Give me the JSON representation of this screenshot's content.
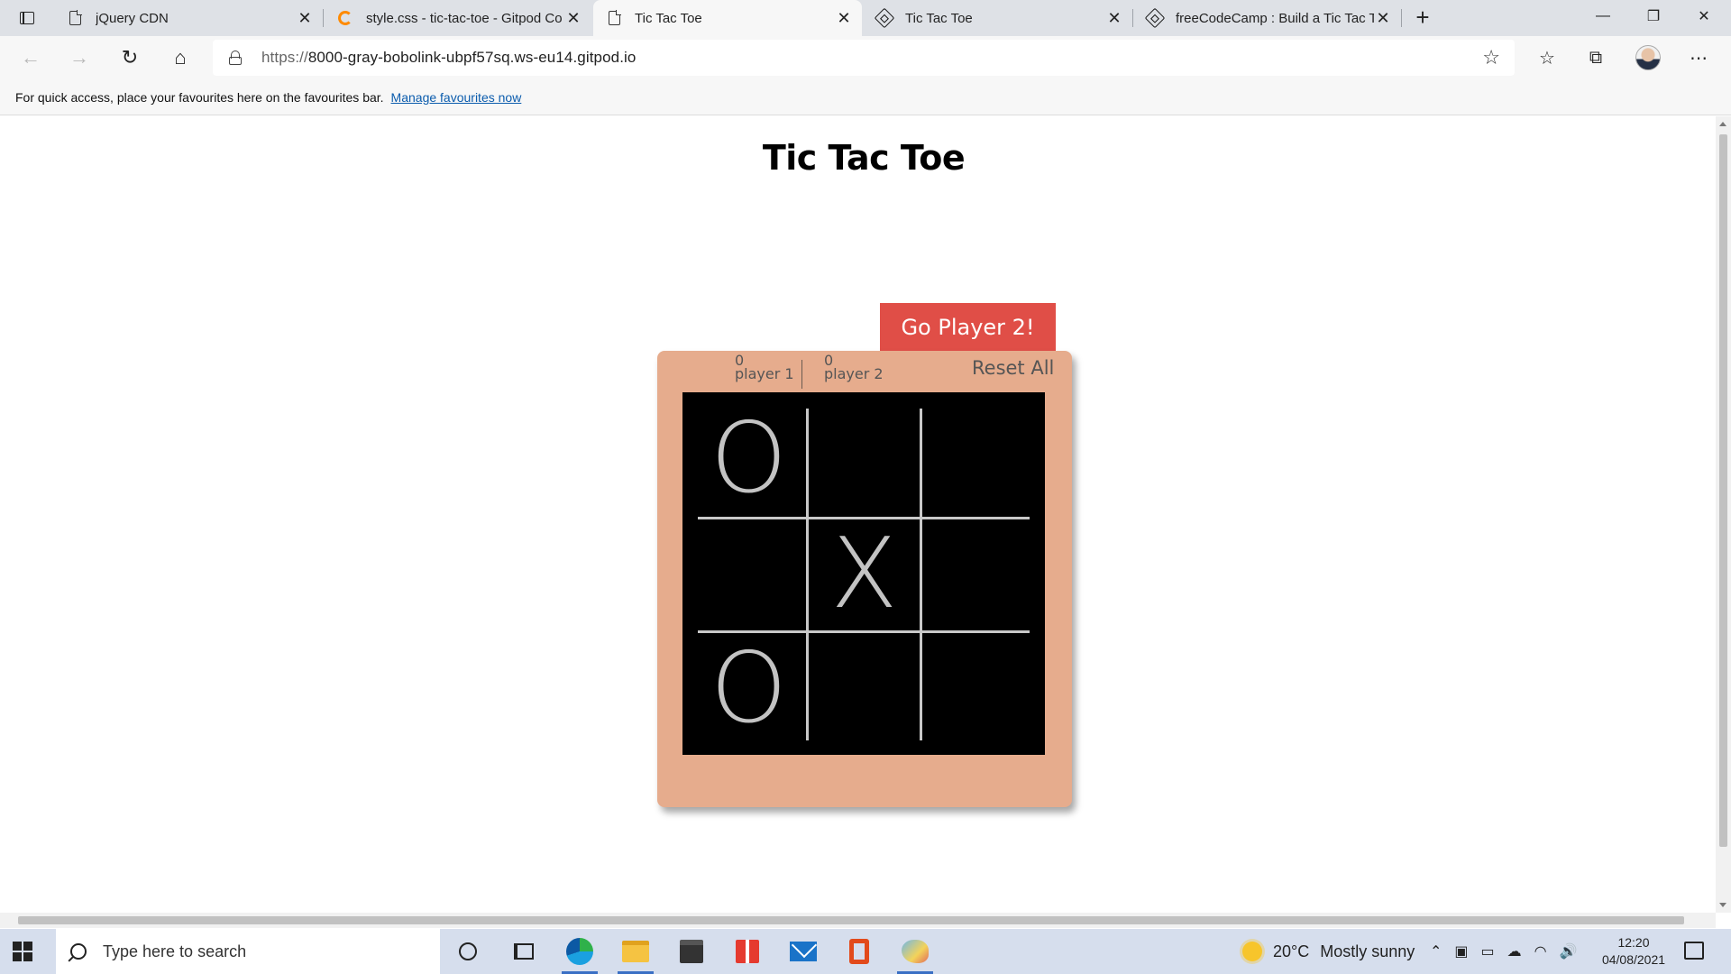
{
  "browser": {
    "tabs": [
      {
        "title": "jQuery CDN",
        "icon": "document-icon"
      },
      {
        "title": "style.css - tic-tac-toe - Gitpod Co",
        "icon": "gitpod-icon"
      },
      {
        "title": "Tic Tac Toe",
        "icon": "document-icon",
        "active": true
      },
      {
        "title": "Tic Tac Toe",
        "icon": "codepen-icon"
      },
      {
        "title": "freeCodeCamp : Build a Tic Tac To",
        "icon": "codepen-icon"
      }
    ],
    "url_scheme": "https://",
    "url_host": "8000-gray-bobolink-ubpf57sq.ws-eu14.gitpod.io",
    "favourites_message": "For quick access, place your favourites here on the favourites bar.",
    "favourites_link": "Manage favourites now"
  },
  "page": {
    "title": "Tic Tac Toe",
    "turn_label": "Go Player 2!",
    "turn_color": "#e04e47",
    "card_color": "#e6ac8d",
    "player1": {
      "score": "0",
      "label": "player 1"
    },
    "player2": {
      "score": "0",
      "label": "player 2"
    },
    "reset_label": "Reset All",
    "board": [
      "O",
      "",
      "",
      "",
      "X",
      "",
      "O",
      "",
      ""
    ]
  },
  "taskbar": {
    "search_placeholder": "Type here to search",
    "weather_temp": "20°C",
    "weather_desc": "Mostly sunny",
    "time": "12:20",
    "date": "04/08/2021"
  }
}
